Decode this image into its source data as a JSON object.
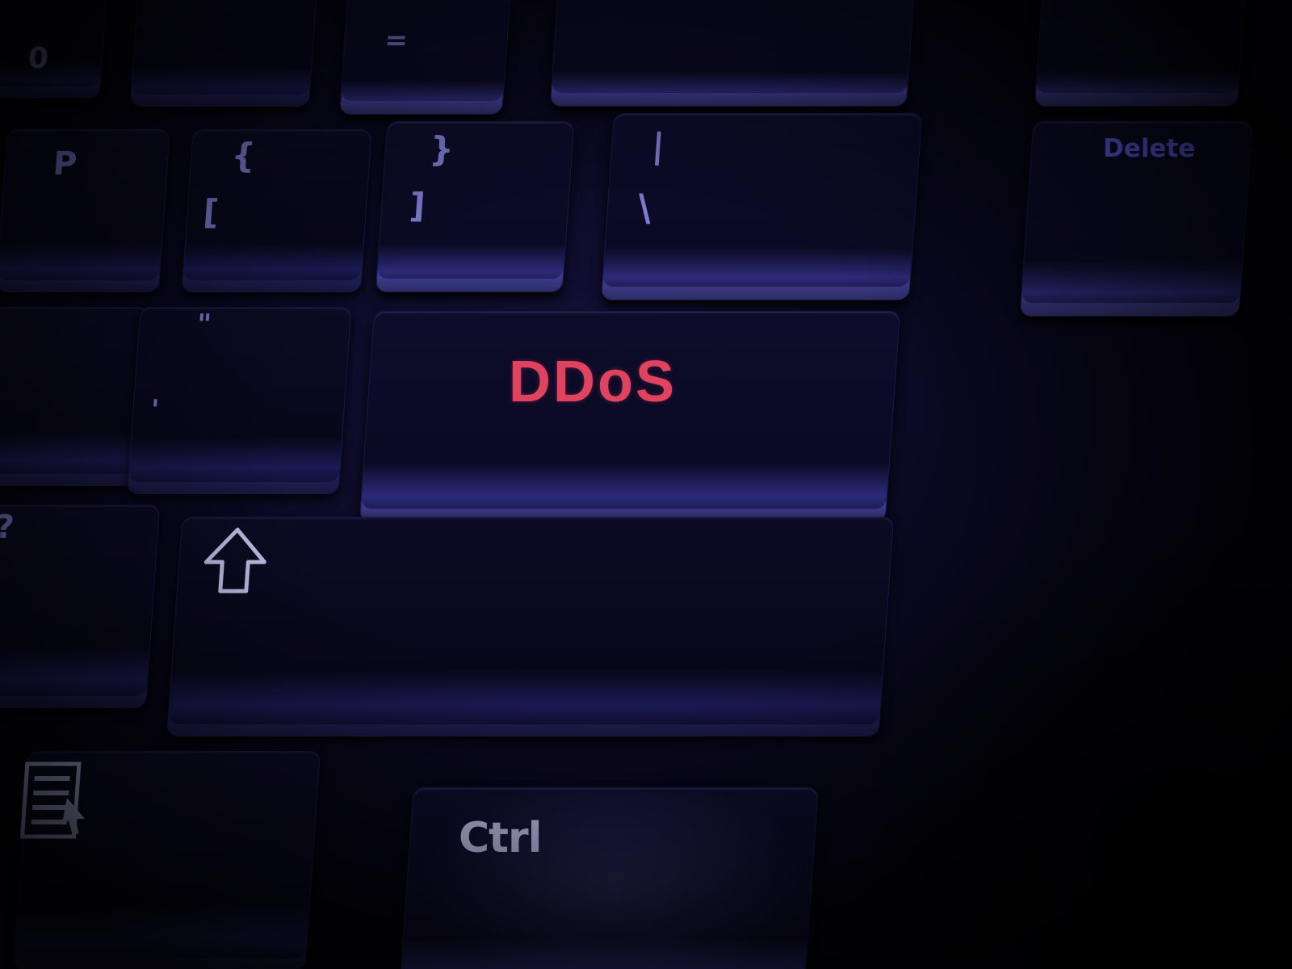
{
  "photo": {
    "subject": "keyboard-closeup",
    "tint_color": "#1a1850"
  },
  "keys": {
    "enter": {
      "label": "DDoS",
      "color": "#e0435f"
    },
    "delete": {
      "label": "Delete",
      "color": "#6a67ff"
    },
    "ctrl": {
      "label": "Ctrl",
      "color": "#c9c8ee"
    },
    "bracket": {
      "top": "{",
      "bottom": "["
    },
    "close_bracket": {
      "top": "}",
      "bottom": "]"
    },
    "backslash": {
      "top": "|",
      "bottom": "\\"
    },
    "quote": {
      "top": "\"",
      "bottom": "'"
    },
    "slash": {
      "top": "?",
      "bottom": "/"
    },
    "equals": "=",
    "p_key": "P",
    "zero_key": "0"
  },
  "icons": {
    "shift": "shift-arrow-icon",
    "menu": "menu-key-icon"
  }
}
